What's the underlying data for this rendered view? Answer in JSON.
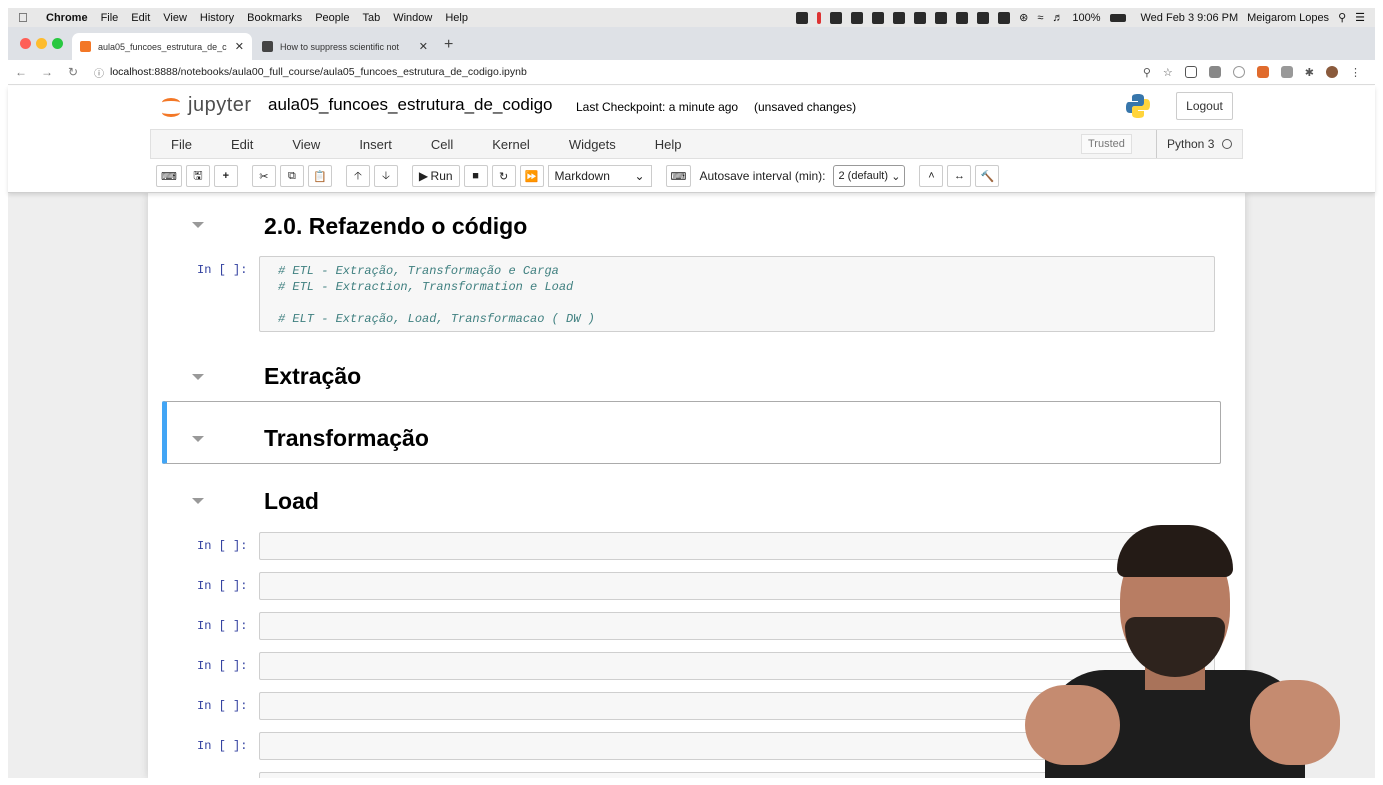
{
  "macmenu": {
    "app": "Chrome",
    "items": [
      "File",
      "Edit",
      "View",
      "History",
      "Bookmarks",
      "People",
      "Tab",
      "Window",
      "Help"
    ],
    "battery": "100%",
    "datetime": "Wed Feb 3  9:06 PM",
    "user": "Meigarom Lopes"
  },
  "tabs": [
    {
      "title": "aula05_funcoes_estrutura_de_c",
      "active": true
    },
    {
      "title": "How to suppress scientific not",
      "active": false
    }
  ],
  "address": {
    "host": "localhost",
    "path": ":8888/notebooks/aula00_full_course/aula05_funcoes_estrutura_de_codigo.ipynb"
  },
  "jupyter": {
    "logo_text": "jupyter",
    "notebook_name": "aula05_funcoes_estrutura_de_codigo",
    "checkpoint": "Last Checkpoint: a minute ago",
    "unsaved": "(unsaved changes)",
    "logout": "Logout",
    "menu": [
      "File",
      "Edit",
      "View",
      "Insert",
      "Cell",
      "Kernel",
      "Widgets",
      "Help"
    ],
    "trusted": "Trusted",
    "kernel": "Python 3",
    "toolbar": {
      "run": "Run",
      "cell_type": "Markdown",
      "autosave_label": "Autosave interval (min):",
      "autosave_value": "2 (default)"
    }
  },
  "cells": {
    "h_refazendo": "2.0. Refazendo o código",
    "code_prompt": "In [ ]:",
    "code_lines": [
      "# ETL - Extração, Transformação e Carga",
      "# ETL - Extraction, Transformation e Load",
      "",
      "# ELT - Extração, Load, Transformacao ( DW )"
    ],
    "h_extracao": "Extração",
    "h_transformacao": "Transformação",
    "h_load": "Load",
    "empty_prompt": "In [ ]:"
  },
  "colors": {
    "jupyter_orange": "#f37726",
    "prompt_blue": "#303f9f",
    "comment_green": "#408080",
    "selected_cell_border": "#42a5f5"
  }
}
